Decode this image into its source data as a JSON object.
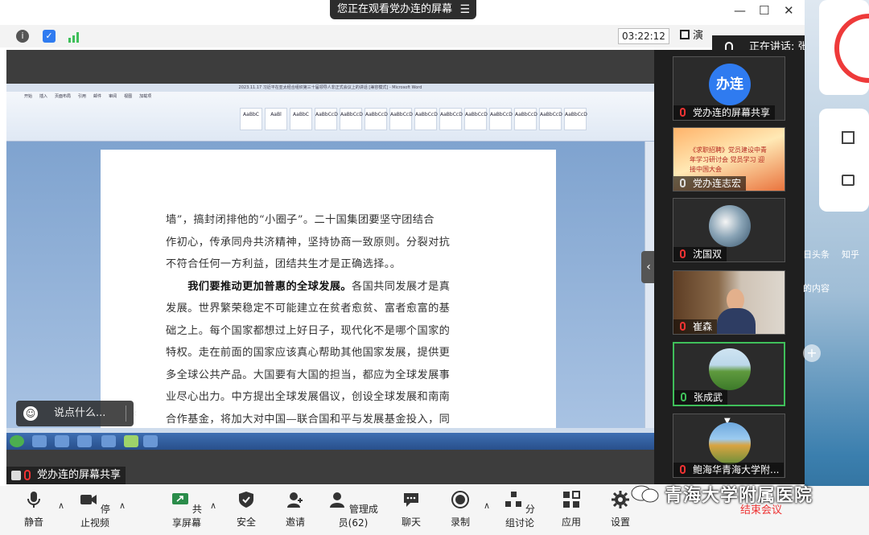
{
  "window": {
    "viewing_banner": "您正在观看党办连的屏幕",
    "menu_glyph": "☰",
    "minimize_glyph": "—",
    "maximize_glyph": "☐",
    "close_glyph": "✕"
  },
  "info_bar": {
    "timer": "03:22:12",
    "layout_label": "演",
    "speaking_label": "正在讲话: 张成武;"
  },
  "shared_screen": {
    "word_title": "2023.11.17 习近平在亚太经合组织第三十届领导人非正式会议上的讲话 [兼容模式] - Microsoft Word",
    "ribbon_tabs": [
      "开始",
      "插入",
      "页面布局",
      "引用",
      "邮件",
      "审阅",
      "视图",
      "加载项"
    ],
    "style_samples": [
      "AaBbC",
      "AaBl",
      "AaBbC",
      "AaBbCcD",
      "AaBbCcD",
      "AaBbCcD",
      "AaBbCcD",
      "AaBbCcD",
      "AaBbCcD",
      "AaBbCcD",
      "AaBbCcD",
      "AaBbCcD",
      "AaBbCcD",
      "AaBbCcD"
    ],
    "lines": [
      "墙”，搞封闭排他的“小圈子”。二十国集团要坚守团结合",
      "作初心，传承同舟共济精神，坚持协商一致原则。分裂对抗",
      "不符合任何一方利益，团结共生才是正确选择。。"
    ],
    "heading_bold": "我们要推动更加普惠的全球发展。",
    "heading_rest": "各国共同发展才是真",
    "lines2": [
      "发展。世界繁荣稳定不可能建立在贫者愈贫、富者愈富的基",
      "础之上。每个国家都想过上好日子，现代化不是哪个国家的",
      "特权。走在前面的国家应该真心帮助其他国家发展，提供更",
      "多全球公共产品。大国要有大国的担当，都应为全球发展事",
      "业尽心出力。中方提出全球发展倡议，创设全球发展和南南",
      "合作基金，将加大对中国—联合国和平与发展基金投入，同"
    ],
    "share_label": "党办连的屏幕共享"
  },
  "chat": {
    "placeholder": "说点什么...",
    "collapse_glyph": "‹"
  },
  "participants": [
    {
      "name": "党办连的屏幕共享",
      "avatar_text": "办连",
      "avatar_color": "#2f7bf0"
    },
    {
      "name": "党办连志宏",
      "banner_text": "《求职招聘》党员建设中青年学习研讨会 党员学习 迎接中国大会"
    },
    {
      "name": "沈国双"
    },
    {
      "name": "崔森"
    },
    {
      "name": "张成武"
    },
    {
      "name": "鲍海华青海大学附..."
    }
  ],
  "toolbar": {
    "mute": "静音",
    "stop_video": "停止视频",
    "share_screen": "共享屏幕",
    "security": "安全",
    "invite": "邀请",
    "manage_members": "管理成员(62)",
    "chat": "聊天",
    "record": "录制",
    "breakout": "分组讨论",
    "apps": "应用",
    "settings": "设置",
    "end_meeting": "结束会议"
  },
  "edge": {
    "tab1": "日头条",
    "tab2": "知乎",
    "content": "的内容"
  },
  "watermark": "青海大学附属医院",
  "colors": {
    "accent_green": "#3fbf5a",
    "end_red": "#e33333",
    "dark_bg": "#1f1f1f"
  }
}
